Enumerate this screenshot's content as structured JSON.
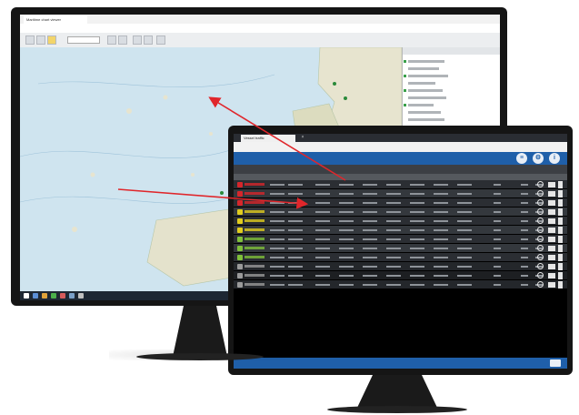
{
  "back_screen": {
    "browser_tab": "Maritime chart viewer",
    "address_bar": "",
    "toolbar_field": ""
  },
  "front_screen": {
    "browser_tab": "Vessel traffic",
    "tab_close": "×",
    "address_bar": "",
    "brand": "",
    "section_title": "",
    "status_left": "",
    "status_mid": "",
    "status_right": "",
    "rows": [
      {
        "status_color": "#d6262b"
      },
      {
        "status_color": "#d6262b"
      },
      {
        "status_color": "#d6262b"
      },
      {
        "status_color": "#e0cc1e"
      },
      {
        "status_color": "#e0cc1e"
      },
      {
        "status_color": "#e0cc1e"
      },
      {
        "status_color": "#7fbf3a"
      },
      {
        "status_color": "#7fbf3a"
      },
      {
        "status_color": "#7fbf3a"
      },
      {
        "status_color": "#9a9a9a"
      },
      {
        "status_color": "#9a9a9a"
      },
      {
        "status_color": "#9a9a9a"
      }
    ],
    "header_icons": [
      "list-icon",
      "settings-icon",
      "info-icon"
    ]
  },
  "colors": {
    "map_sea": "#cfe4ef",
    "map_land": "#e7e4cf",
    "app_blue": "#1f5fa9",
    "arrow_red": "#e0262b",
    "bezel": "#151515"
  }
}
